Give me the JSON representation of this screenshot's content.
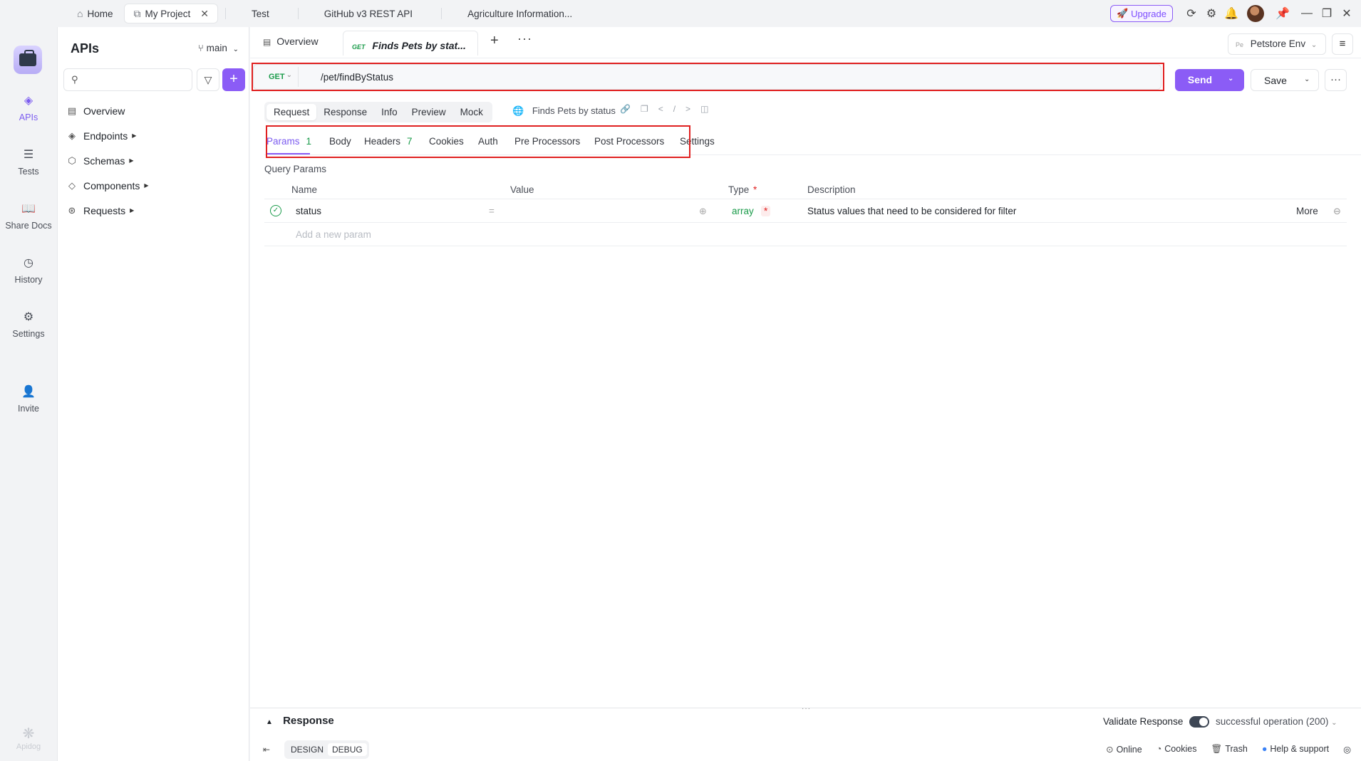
{
  "titlebar": {
    "tabs": [
      {
        "label": "Home",
        "icon": "home-icon"
      },
      {
        "label": "My Project",
        "icon": "project-icon",
        "active": true
      },
      {
        "label": "Test"
      },
      {
        "label": "GitHub v3 REST API"
      },
      {
        "label": "Agriculture Information..."
      }
    ],
    "upgrade_label": "Upgrade"
  },
  "rail": {
    "items": [
      {
        "label": "APIs",
        "icon": "api-icon",
        "active": true
      },
      {
        "label": "Tests",
        "icon": "tests-icon"
      },
      {
        "label": "Share Docs",
        "icon": "book-icon"
      },
      {
        "label": "History",
        "icon": "clock-icon"
      },
      {
        "label": "Settings",
        "icon": "gear-icon"
      },
      {
        "label": "Invite",
        "icon": "add-user-icon"
      }
    ],
    "brand": "Apidog"
  },
  "sidebar": {
    "title": "APIs",
    "branch": "main",
    "search_placeholder": "",
    "nav": [
      {
        "label": "Overview"
      },
      {
        "label": "Endpoints"
      },
      {
        "label": "Schemas"
      },
      {
        "label": "Components"
      },
      {
        "label": "Requests"
      }
    ]
  },
  "main": {
    "overview_tab": "Overview",
    "active_tab": {
      "method": "GET",
      "label": "Finds Pets by stat..."
    },
    "env": {
      "badge": "Pe",
      "label": "Petstore Env"
    },
    "request": {
      "method": "GET",
      "url": "/pet/findByStatus"
    },
    "send_label": "Send",
    "save_label": "Save",
    "subtabs": [
      "Request",
      "Response",
      "Info",
      "Preview",
      "Mock"
    ],
    "api_name": "Finds Pets by status",
    "param_tabs": [
      {
        "label": "Params",
        "count": "1"
      },
      {
        "label": "Body"
      },
      {
        "label": "Headers",
        "count": "7"
      },
      {
        "label": "Cookies"
      },
      {
        "label": "Auth"
      },
      {
        "label": "Pre Processors"
      },
      {
        "label": "Post Processors"
      },
      {
        "label": "Settings"
      }
    ],
    "query_params_title": "Query Params",
    "columns": {
      "name": "Name",
      "value": "Value",
      "type": "Type",
      "required": "*",
      "description": "Description"
    },
    "rows": [
      {
        "name": "status",
        "eq": "=",
        "value": "",
        "type": "array",
        "required": "*",
        "description": "Status values that need to be considered for filter",
        "more": "More"
      }
    ],
    "add_param_placeholder": "Add a new param"
  },
  "response_panel": {
    "title": "Response",
    "validate_label": "Validate Response",
    "validate_on": true,
    "status": "successful operation (200)"
  },
  "footer": {
    "modes": [
      "DESIGN",
      "DEBUG"
    ],
    "active_mode": "DEBUG",
    "links": [
      "Online",
      "Cookies",
      "Trash",
      "Help & support"
    ]
  },
  "colors": {
    "accent": "#8b5cf6",
    "get": "#1a9b4a",
    "highlight": "#e02020"
  }
}
